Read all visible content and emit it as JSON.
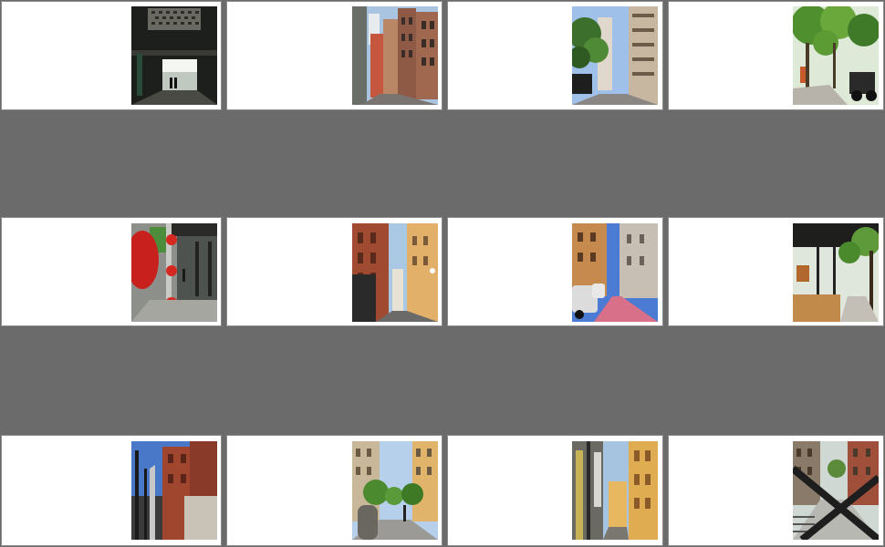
{
  "sheet": {
    "background": "#6b6b6b",
    "card_color": "#ffffff"
  },
  "photos": [
    {
      "id": 1,
      "subject": "tunnel-icon",
      "caption": ""
    },
    {
      "id": 2,
      "subject": "street-icon",
      "caption": ""
    },
    {
      "id": 3,
      "subject": "tree-street-icon",
      "caption": ""
    },
    {
      "id": 4,
      "subject": "tree-sidewalk-icon",
      "caption": ""
    },
    {
      "id": 5,
      "subject": "red-lantern-icon",
      "caption": ""
    },
    {
      "id": 6,
      "subject": "brick-street-icon",
      "caption": ""
    },
    {
      "id": 7,
      "subject": "parked-cars-icon",
      "caption": ""
    },
    {
      "id": 8,
      "subject": "cafe-terrace-icon",
      "caption": ""
    },
    {
      "id": 9,
      "subject": "railing-icon",
      "caption": ""
    },
    {
      "id": 10,
      "subject": "boulevard-icon",
      "caption": ""
    },
    {
      "id": 11,
      "subject": "narrow-alley-icon",
      "caption": ""
    },
    {
      "id": 12,
      "subject": "crossed-street-icon",
      "caption": ""
    }
  ]
}
